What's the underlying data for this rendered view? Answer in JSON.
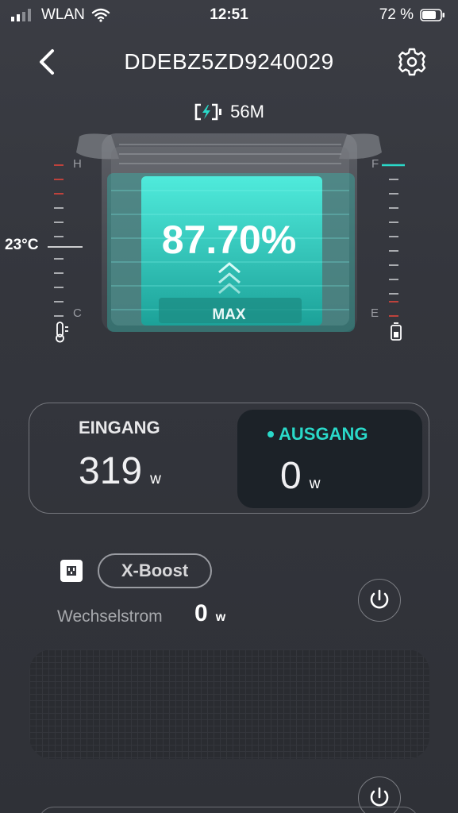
{
  "status_bar": {
    "network": "WLAN",
    "time": "12:51",
    "battery_percent": "72 %"
  },
  "nav": {
    "title": "DDEBZ5ZD9240029",
    "back_icon": "chevron-left-icon",
    "settings_icon": "gear-icon"
  },
  "battery": {
    "remaining_time": "56M",
    "charge_percent": "87.70%",
    "mode_label": "MAX",
    "temperature": "23°C",
    "temp_scale_high": "H",
    "temp_scale_low": "C",
    "level_scale_full": "F",
    "level_scale_empty": "E"
  },
  "io": {
    "input_label": "EINGANG",
    "input_value": "319",
    "input_unit": "w",
    "output_label": "AUSGANG",
    "output_value": "0",
    "output_unit": "w"
  },
  "ac": {
    "xboost_label": "X-Boost",
    "label": "Wechselstrom",
    "value": "0",
    "unit": "w"
  },
  "colors": {
    "accent": "#2ad9c9",
    "background": "#34363d",
    "warning": "#e0453c"
  }
}
